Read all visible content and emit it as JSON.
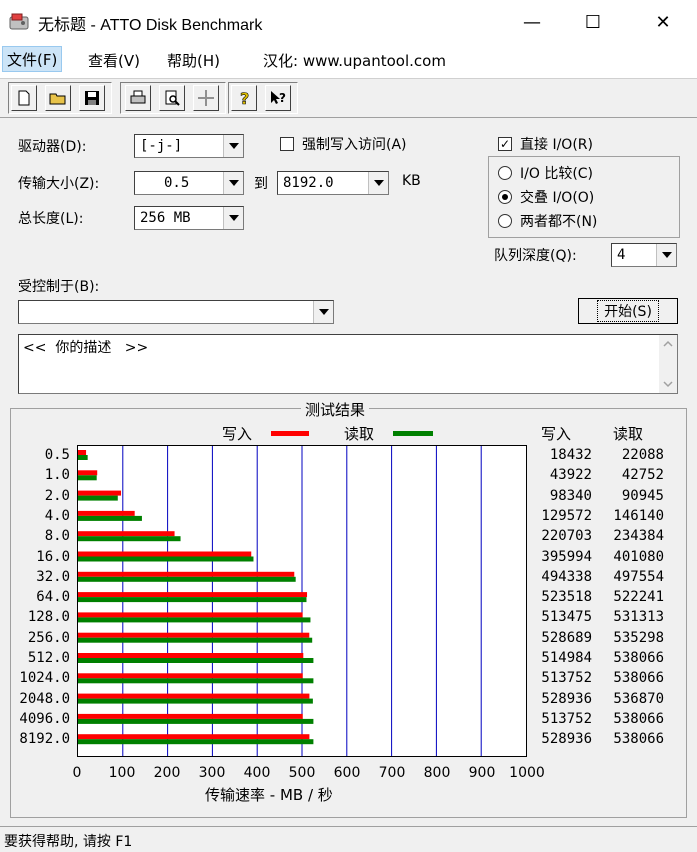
{
  "window": {
    "title": "无标题 - ATTO Disk Benchmark",
    "minimize": "—",
    "maximize": "☐",
    "close": "✕"
  },
  "menu": {
    "file": "文件(F)",
    "view": "查看(V)",
    "help": "帮助(H)",
    "localized": "汉化: www.upantool.com"
  },
  "toolbar": {
    "icons": [
      "new-file-icon",
      "open-folder-icon",
      "save-icon",
      "print-icon",
      "print-preview-icon",
      "move-icon",
      "help-icon",
      "context-help-icon"
    ]
  },
  "settings": {
    "drive_label": "驱动器(D):",
    "drive_value": "[-j-]",
    "transfer_label": "传输大小(Z):",
    "transfer_from": "0.5",
    "to_label": "到",
    "transfer_to": "8192.0",
    "kb_label": "KB",
    "total_label": "总长度(L):",
    "total_value": "256 MB",
    "force_write_label": "强制写入访问(A)",
    "force_write_checked": false,
    "direct_io_label": "直接 I/O(R)",
    "direct_io_checked": true,
    "radio_io_compare": "I/O 比较(C)",
    "radio_overlapped": "交叠 I/O(O)",
    "radio_neither": "两者都不(N)",
    "selected_radio": "overlapped",
    "queue_label": "队列深度(Q):",
    "queue_value": "4",
    "controlled_label": "受控制于(B):",
    "controlled_value": "",
    "start_button": "开始(S)",
    "description": "<<  你的描述   >>"
  },
  "results": {
    "title": "测试结果",
    "legend_write": "写入",
    "legend_read": "读取",
    "col_write": "写入",
    "col_read": "读取",
    "write_color": "#ff0000",
    "read_color": "#008000"
  },
  "chart_data": {
    "type": "bar",
    "categories": [
      "0.5",
      "1.0",
      "2.0",
      "4.0",
      "8.0",
      "16.0",
      "32.0",
      "64.0",
      "128.0",
      "256.0",
      "512.0",
      "1024.0",
      "2048.0",
      "4096.0",
      "8192.0"
    ],
    "series": [
      {
        "name": "写入",
        "values": [
          18432,
          43922,
          98340,
          129572,
          220703,
          395994,
          494338,
          523518,
          513475,
          528689,
          514984,
          513752,
          528936,
          513752,
          528936
        ]
      },
      {
        "name": "读取",
        "values": [
          22088,
          42752,
          90945,
          146140,
          234384,
          401080,
          497554,
          522241,
          531313,
          535298,
          538066,
          538066,
          536870,
          538066,
          538066
        ]
      }
    ],
    "xlabel": "传输速率 - MB / 秒",
    "xticks": [
      "0",
      "100",
      "200",
      "300",
      "400",
      "500",
      "600",
      "700",
      "800",
      "900",
      "1000"
    ],
    "xlim": [
      0,
      1000
    ],
    "orientation": "horizontal"
  },
  "status": {
    "text": "要获得帮助, 请按 F1"
  }
}
